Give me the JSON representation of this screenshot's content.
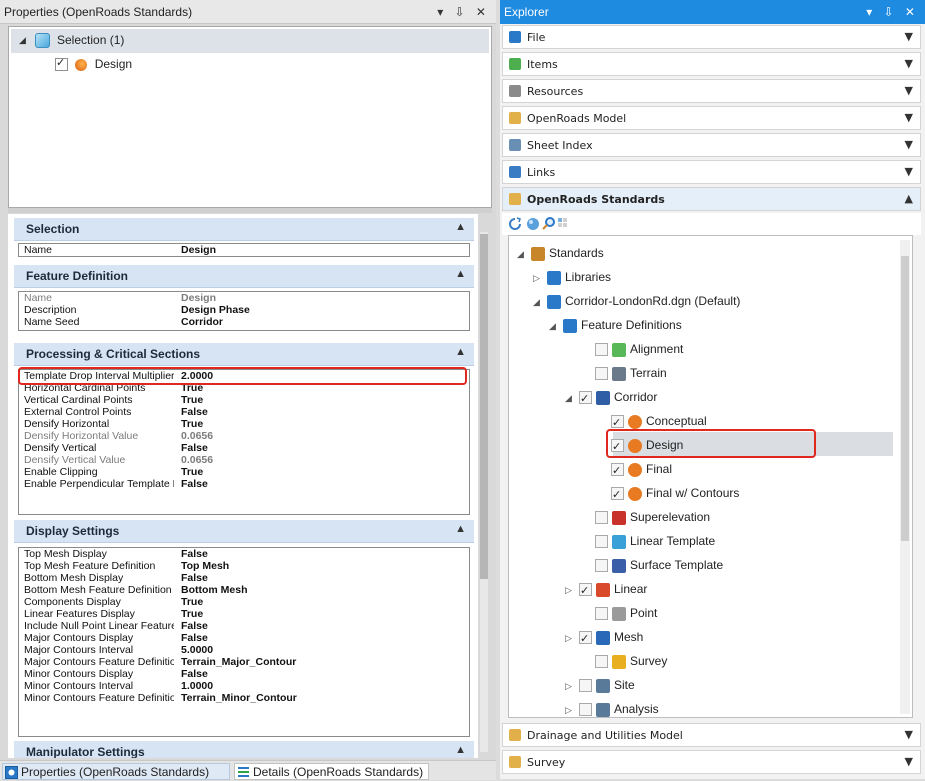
{
  "left_panel": {
    "title": "Properties (OpenRoads Standards)",
    "controls": "▾ ⇩ ✕",
    "tree": {
      "selection_label": "Selection (1)",
      "design_label": "Design"
    },
    "sections": {
      "selection": {
        "title": "Selection",
        "rows": [
          {
            "k": "Name",
            "v": "Design"
          }
        ]
      },
      "feature_definition": {
        "title": "Feature Definition",
        "rows": [
          {
            "k": "Name",
            "v": "Design",
            "dim": true
          },
          {
            "k": "Description",
            "v": "Design Phase"
          },
          {
            "k": "Name Seed",
            "v": "Corridor"
          }
        ]
      },
      "processing": {
        "title": "Processing & Critical Sections",
        "rows": [
          {
            "k": "Template Drop Interval Multiplier",
            "v": "2.0000"
          },
          {
            "k": "Horizontal Cardinal Points",
            "v": "True"
          },
          {
            "k": "Vertical Cardinal Points",
            "v": "True"
          },
          {
            "k": "External Control Points",
            "v": "False"
          },
          {
            "k": "Densify Horizontal",
            "v": "True"
          },
          {
            "k": "Densify Horizontal Value",
            "v": "0.0656",
            "dim": true
          },
          {
            "k": "Densify Vertical",
            "v": "False"
          },
          {
            "k": "Densify Vertical Value",
            "v": "0.0656",
            "dim": true
          },
          {
            "k": "Enable Clipping",
            "v": "True"
          },
          {
            "k": "Enable Perpendicular Template Dr",
            "v": "False"
          }
        ]
      },
      "display": {
        "title": "Display Settings",
        "rows": [
          {
            "k": "Top Mesh Display",
            "v": "False"
          },
          {
            "k": "Top Mesh Feature Definition",
            "v": "Top Mesh"
          },
          {
            "k": "Bottom Mesh Display",
            "v": "False"
          },
          {
            "k": "Bottom Mesh Feature Definition",
            "v": "Bottom Mesh"
          },
          {
            "k": "Components Display",
            "v": "True"
          },
          {
            "k": "Linear Features Display",
            "v": "True"
          },
          {
            "k": "Include Null Point Linear Features",
            "v": "False"
          },
          {
            "k": "Major Contours Display",
            "v": "False"
          },
          {
            "k": "Major Contours Interval",
            "v": "5.0000"
          },
          {
            "k": "Major Contours Feature Definition",
            "v": "Terrain_Major_Contour"
          },
          {
            "k": "Minor Contours Display",
            "v": "False"
          },
          {
            "k": "Minor Contours Interval",
            "v": "1.0000"
          },
          {
            "k": "Minor Contours Feature Definition",
            "v": "Terrain_Minor_Contour"
          }
        ]
      },
      "manipulator": {
        "title": "Manipulator Settings"
      }
    },
    "bottom_tabs": [
      "Properties (OpenRoads Standards)",
      "Details (OpenRoads Standards)"
    ]
  },
  "explorer": {
    "title": "Explorer",
    "controls": "▾ ⇩ ✕",
    "accordion": [
      {
        "label": "File",
        "icon": "file-icon"
      },
      {
        "label": "Items",
        "icon": "items-icon"
      },
      {
        "label": "Resources",
        "icon": "resources-icon"
      },
      {
        "label": "OpenRoads Model",
        "icon": "model-icon"
      },
      {
        "label": "Sheet Index",
        "icon": "sheet-index-icon"
      },
      {
        "label": "Links",
        "icon": "links-icon"
      },
      {
        "label": "OpenRoads Standards",
        "icon": "standards-icon"
      }
    ],
    "bottom_accordion": [
      {
        "label": "Drainage and Utilities Model",
        "icon": "drainage-icon"
      },
      {
        "label": "Survey",
        "icon": "survey-icon"
      }
    ],
    "tree": {
      "standards": "Standards",
      "libraries": "Libraries",
      "dgn": "Corridor-LondonRd.dgn (Default)",
      "feature_definitions": "Feature Definitions",
      "alignment": "Alignment",
      "terrain": "Terrain",
      "corridor": "Corridor",
      "conceptual": "Conceptual",
      "design": "Design",
      "final": "Final",
      "final_contours": "Final w/ Contours",
      "superelevation": "Superelevation",
      "linear_template": "Linear Template",
      "surface_template": "Surface Template",
      "linear": "Linear",
      "point": "Point",
      "mesh": "Mesh",
      "survey": "Survey",
      "site": "Site",
      "analysis": "Analysis"
    }
  }
}
